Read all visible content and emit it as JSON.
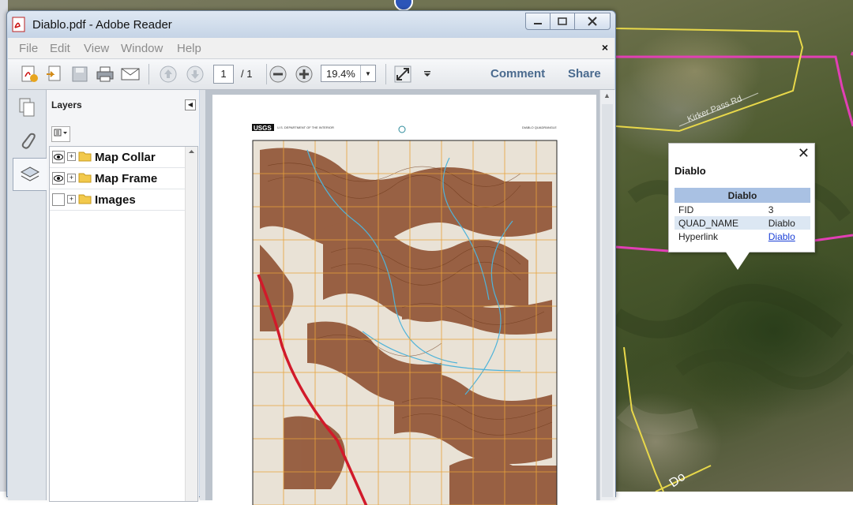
{
  "window": {
    "title": "Diablo.pdf - Adobe Reader",
    "caption_buttons": [
      "minimize-icon",
      "maximize-icon",
      "close-icon"
    ]
  },
  "menubar": {
    "items": [
      "File",
      "Edit",
      "View",
      "Window",
      "Help"
    ],
    "close_label": "×"
  },
  "toolbar": {
    "page_number": "1",
    "page_total": "/ 1",
    "zoom": "19.4%",
    "comment_label": "Comment",
    "share_label": "Share"
  },
  "layers_panel": {
    "title": "Layers",
    "items": [
      {
        "label": "Map Collar",
        "visible": true
      },
      {
        "label": "Map Frame",
        "visible": true
      },
      {
        "label": "Images",
        "visible": false
      }
    ]
  },
  "map_page": {
    "agency": "U.S. DEPARTMENT OF THE INTERIOR",
    "logo_text": "USGS",
    "quadrangle": "DIABLO QUADRANGLE"
  },
  "popup": {
    "title": "Diablo",
    "table_header": "Diablo",
    "rows": [
      {
        "key": "FID",
        "value": "3"
      },
      {
        "key": "QUAD_NAME",
        "value": "Diablo"
      },
      {
        "key": "Hyperlink",
        "value": "Diablo"
      }
    ]
  },
  "colors": {
    "boundary_magenta": "#e23fb5",
    "boundary_yellow": "#e8d84a",
    "popup_header": "#a9c1e3",
    "link": "#1a3fd6"
  }
}
